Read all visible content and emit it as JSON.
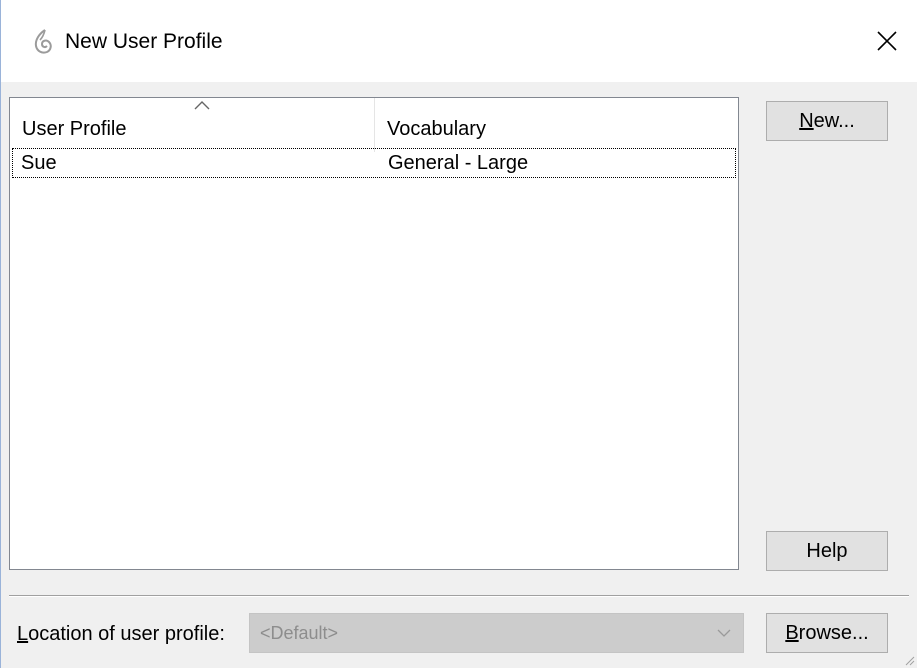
{
  "window": {
    "title": "New User Profile",
    "icons": {
      "app": "dragon-icon",
      "close": "close-icon"
    }
  },
  "profiles_list": {
    "columns": [
      "User Profile",
      "Vocabulary"
    ],
    "sort_indicator": "ascending",
    "rows": [
      {
        "user_profile": "Sue",
        "vocabulary": "General - Large",
        "focused": true
      }
    ]
  },
  "buttons": {
    "new": {
      "label": "New...",
      "mnemonic": "N",
      "rest": "ew..."
    },
    "help": {
      "label": "Help"
    },
    "browse": {
      "label": "Browse...",
      "mnemonic": "B",
      "rest": "rowse..."
    }
  },
  "location": {
    "label": "Location of user profile:",
    "label_mnemonic": "L",
    "label_rest": "ocation of user profile:",
    "value": "<Default>",
    "enabled": false
  },
  "colors": {
    "background": "#f0f0f0",
    "titlebar": "#ffffff",
    "button_face": "#e1e1e1",
    "disabled_combo": "#cccccc",
    "disabled_text": "#8d8d8d"
  }
}
